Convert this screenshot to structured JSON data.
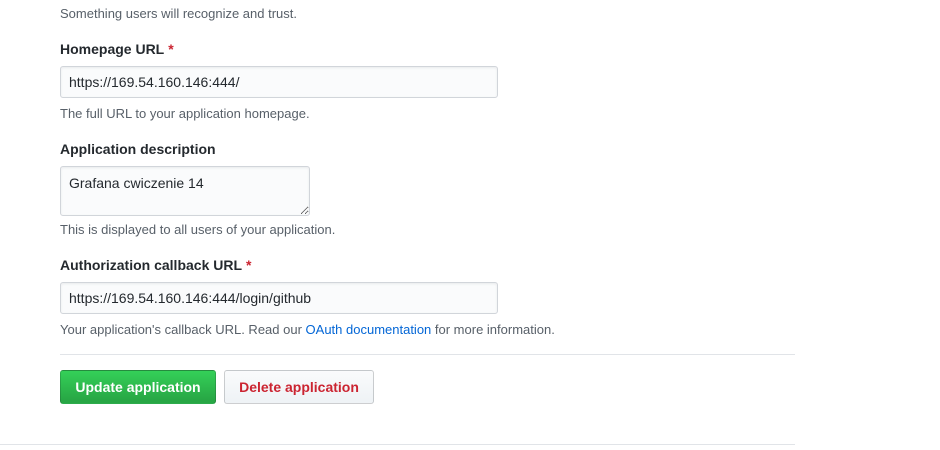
{
  "app_name_note": "Something users will recognize and trust.",
  "homepage": {
    "label": "Homepage URL",
    "required_mark": "*",
    "value": "https://169.54.160.146:444/",
    "note": "The full URL to your application homepage."
  },
  "description": {
    "label": "Application description",
    "value": "Grafana cwiczenie 14",
    "note": "This is displayed to all users of your application."
  },
  "callback": {
    "label": "Authorization callback URL",
    "required_mark": "*",
    "value": "https://169.54.160.146:444/login/github",
    "note_before": "Your application's callback URL. Read our ",
    "note_link": "OAuth documentation",
    "note_after": " for more information."
  },
  "actions": {
    "update_label": "Update application",
    "delete_label": "Delete application"
  },
  "colors": {
    "required": "#cb2431",
    "link": "#0366d6",
    "primary_button": "#28a745",
    "danger_text": "#cb2431"
  }
}
